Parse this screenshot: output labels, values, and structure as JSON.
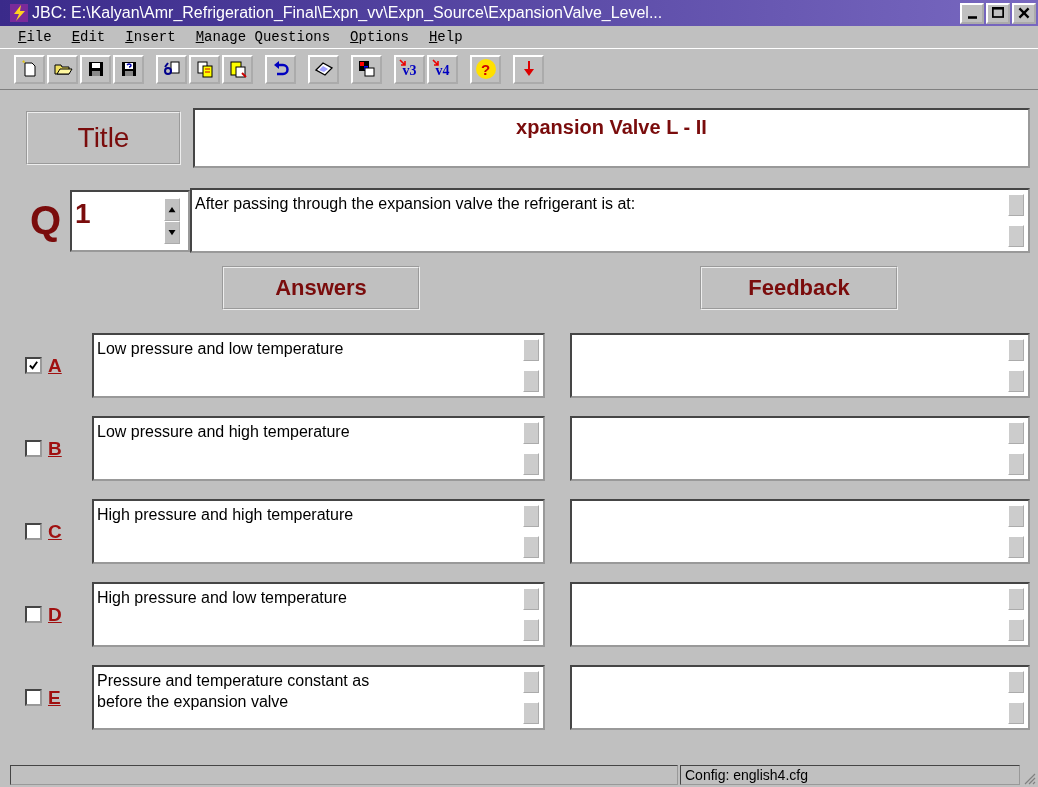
{
  "window": {
    "title": "JBC: E:\\Kalyan\\Amr_Refrigeration_Final\\Expn_vv\\Expn_Source\\ExpansionValve_Level..."
  },
  "menu": [
    "File",
    "Edit",
    "Insert",
    "Manage Questions",
    "Options",
    "Help"
  ],
  "toolbar": [
    [
      {
        "kind": "new"
      },
      {
        "kind": "open"
      },
      {
        "kind": "save"
      },
      {
        "kind": "saveas"
      }
    ],
    [
      {
        "kind": "find"
      },
      {
        "kind": "copy"
      },
      {
        "kind": "paste"
      }
    ],
    [
      {
        "kind": "undo"
      }
    ],
    [
      {
        "kind": "erase"
      }
    ],
    [
      {
        "kind": "palette"
      }
    ],
    [
      {
        "kind": "version",
        "label": "v3"
      },
      {
        "kind": "version",
        "label": "v4"
      }
    ],
    [
      {
        "kind": "help",
        "label": "?"
      }
    ],
    [
      {
        "kind": "down"
      }
    ]
  ],
  "title_label": "Title",
  "title_value": "xpansion Valve  L - II",
  "question_letter": "Q",
  "question_number": "1",
  "question_text": "After passing through the expansion valve the refrigerant is at:",
  "answers_header": "Answers",
  "feedback_header": "Feedback",
  "answers": [
    {
      "letter": "A",
      "checked": true,
      "text": "Low pressure and low temperature"
    },
    {
      "letter": "B",
      "checked": false,
      "text": "Low pressure and high temperature"
    },
    {
      "letter": "C",
      "checked": false,
      "text": "High pressure and high temperature"
    },
    {
      "letter": "D",
      "checked": false,
      "text": "High pressure and low temperature"
    },
    {
      "letter": "E",
      "checked": false,
      "text": "Pressure and temperature constant as before the expansion valve"
    }
  ],
  "status_bar": {
    "config": "Config: english4.cfg"
  }
}
